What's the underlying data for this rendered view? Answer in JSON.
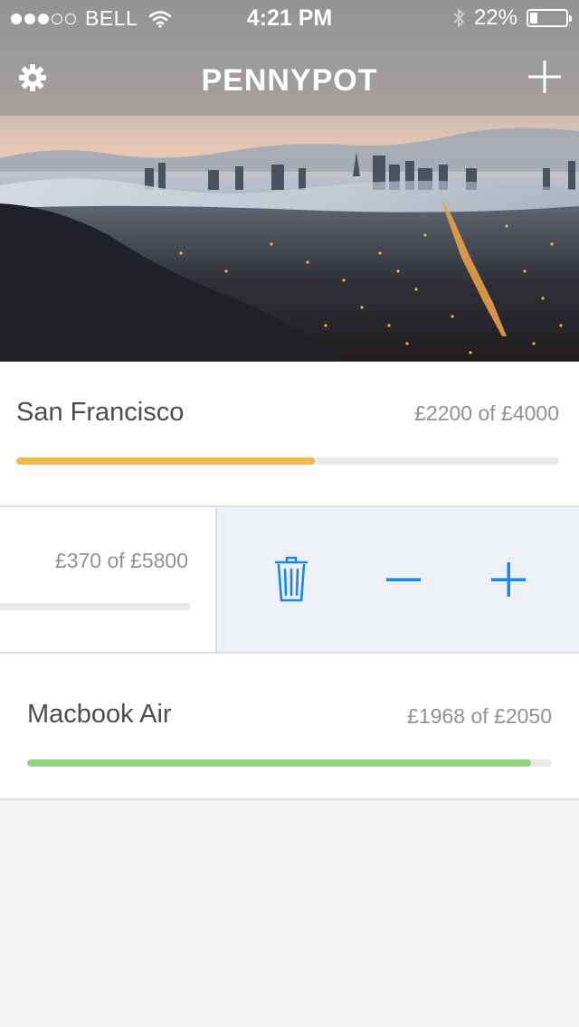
{
  "status_bar": {
    "carrier": "BELL",
    "time": "4:21 PM",
    "battery": "22%",
    "signal_bars": 3,
    "signal_total": 5,
    "battery_level": 0.22
  },
  "nav": {
    "title": "PENNYPOT",
    "settings_icon": "gear-icon",
    "add_icon": "plus-icon"
  },
  "goals": [
    {
      "name": "San Francisco",
      "amount": "£2200 of £4000",
      "progress": 0.55,
      "color": "#f0b84a"
    },
    {
      "name": "",
      "amount": "£370 of £5800",
      "progress": 0.0638,
      "color": "#6cb8f0"
    },
    {
      "name": "Macbook Air",
      "amount": "£1968 of £2050",
      "progress": 0.96,
      "color": "#8fd47a"
    }
  ],
  "actions": {
    "accent": "#1a87e8",
    "delete_icon": "trash-icon",
    "decrease_icon": "minus-icon",
    "increase_icon": "plus-icon"
  }
}
